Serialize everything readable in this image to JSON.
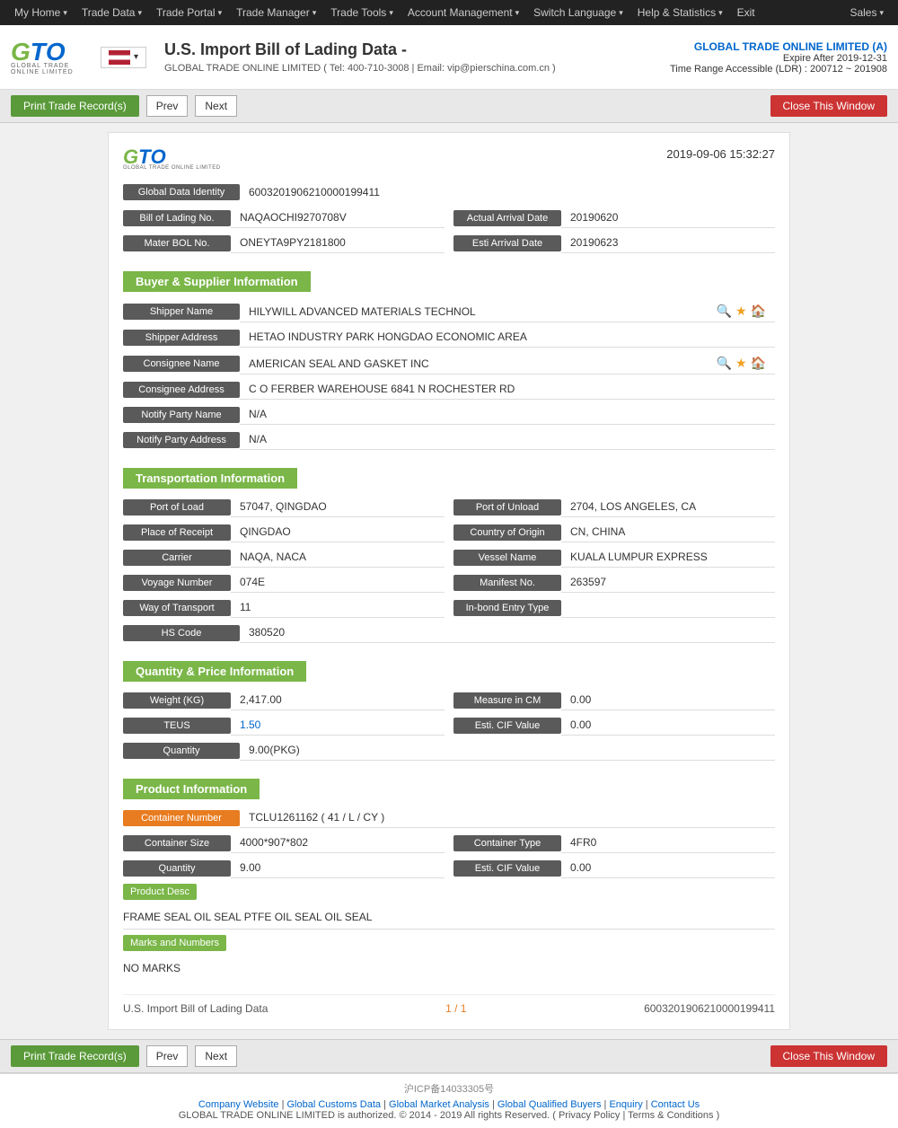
{
  "nav": {
    "items": [
      {
        "label": "My Home",
        "hasArrow": true
      },
      {
        "label": "Trade Data",
        "hasArrow": true
      },
      {
        "label": "Trade Portal",
        "hasArrow": true
      },
      {
        "label": "Trade Manager",
        "hasArrow": true
      },
      {
        "label": "Trade Tools",
        "hasArrow": true
      },
      {
        "label": "Account Management",
        "hasArrow": true
      },
      {
        "label": "Switch Language",
        "hasArrow": true
      },
      {
        "label": "Help & Statistics",
        "hasArrow": true
      },
      {
        "label": "Exit",
        "hasArrow": false
      }
    ],
    "sales": "Sales"
  },
  "header": {
    "title": "U.S. Import Bill of Lading Data  -",
    "company_info": "GLOBAL TRADE ONLINE LIMITED ( Tel: 400-710-3008 | Email: vip@pierschina.com.cn )",
    "right_company": "GLOBAL TRADE ONLINE LIMITED (A)",
    "expire": "Expire After 2019-12-31",
    "ldr": "Time Range Accessible (LDR) : 200712 ~ 201908"
  },
  "toolbar": {
    "print_label": "Print Trade Record(s)",
    "prev_label": "Prev",
    "next_label": "Next",
    "close_label": "Close This Window"
  },
  "record": {
    "date": "2019-09-06 15:32:27",
    "global_data_identity_label": "Global Data Identity",
    "global_data_identity_value": "6003201906210000199411",
    "bill_of_lading_label": "Bill of Lading No.",
    "bill_of_lading_value": "NAQAOCHI9270708V",
    "actual_arrival_label": "Actual Arrival Date",
    "actual_arrival_value": "20190620",
    "master_bol_label": "Mater BOL No.",
    "master_bol_value": "ONEYTA9PY2181800",
    "esti_arrival_label": "Esti Arrival Date",
    "esti_arrival_value": "20190623",
    "buyer_supplier_section": "Buyer & Supplier Information",
    "shipper_name_label": "Shipper Name",
    "shipper_name_value": "HILYWILL ADVANCED MATERIALS TECHNOL",
    "shipper_address_label": "Shipper Address",
    "shipper_address_value": "HETAO INDUSTRY PARK HONGDAO ECONOMIC AREA",
    "consignee_name_label": "Consignee Name",
    "consignee_name_value": "AMERICAN SEAL AND GASKET INC",
    "consignee_address_label": "Consignee Address",
    "consignee_address_value": "C O FERBER WAREHOUSE 6841 N ROCHESTER RD",
    "notify_party_name_label": "Notify Party Name",
    "notify_party_name_value": "N/A",
    "notify_party_address_label": "Notify Party Address",
    "notify_party_address_value": "N/A",
    "transportation_section": "Transportation Information",
    "port_of_load_label": "Port of Load",
    "port_of_load_value": "57047, QINGDAO",
    "port_of_unload_label": "Port of Unload",
    "port_of_unload_value": "2704, LOS ANGELES, CA",
    "place_of_receipt_label": "Place of Receipt",
    "place_of_receipt_value": "QINGDAO",
    "country_of_origin_label": "Country of Origin",
    "country_of_origin_value": "CN, CHINA",
    "carrier_label": "Carrier",
    "carrier_value": "NAQA, NACA",
    "vessel_name_label": "Vessel Name",
    "vessel_name_value": "KUALA LUMPUR EXPRESS",
    "voyage_number_label": "Voyage Number",
    "voyage_number_value": "074E",
    "manifest_no_label": "Manifest No.",
    "manifest_no_value": "263597",
    "way_of_transport_label": "Way of Transport",
    "way_of_transport_value": "11",
    "inbond_entry_label": "In-bond Entry Type",
    "inbond_entry_value": "",
    "hs_code_label": "HS Code",
    "hs_code_value": "380520",
    "quantity_price_section": "Quantity & Price Information",
    "weight_label": "Weight (KG)",
    "weight_value": "2,417.00",
    "measure_cm_label": "Measure in CM",
    "measure_cm_value": "0.00",
    "teus_label": "TEUS",
    "teus_value": "1.50",
    "esti_cif_label": "Esti. CIF Value",
    "esti_cif_value": "0.00",
    "quantity_label": "Quantity",
    "quantity_value": "9.00(PKG)",
    "product_section": "Product Information",
    "container_number_label": "Container Number",
    "container_number_value": "TCLU1261162 ( 41 / L / CY )",
    "container_size_label": "Container Size",
    "container_size_value": "4000*907*802",
    "container_type_label": "Container Type",
    "container_type_value": "4FR0",
    "product_quantity_label": "Quantity",
    "product_quantity_value": "9.00",
    "product_esti_cif_label": "Esti. CIF Value",
    "product_esti_cif_value": "0.00",
    "product_desc_label": "Product Desc",
    "product_desc_value": "FRAME SEAL OIL SEAL PTFE OIL SEAL OIL SEAL",
    "marks_label": "Marks and Numbers",
    "marks_value": "NO MARKS",
    "footer_title": "U.S. Import Bill of Lading Data",
    "footer_page": "1 / 1",
    "footer_id": "6003201906210000199411"
  },
  "footer": {
    "icp": "沪ICP备14033305号",
    "links": [
      {
        "label": "Company Website"
      },
      {
        "label": "Global Customs Data"
      },
      {
        "label": "Global Market Analysis"
      },
      {
        "label": "Global Qualified Buyers"
      },
      {
        "label": "Enquiry"
      },
      {
        "label": "Contact Us"
      }
    ],
    "copyright": "GLOBAL TRADE ONLINE LIMITED is authorized. © 2014 - 2019 All rights Reserved.  (  Privacy Policy  |  Terms & Conditions  )"
  }
}
